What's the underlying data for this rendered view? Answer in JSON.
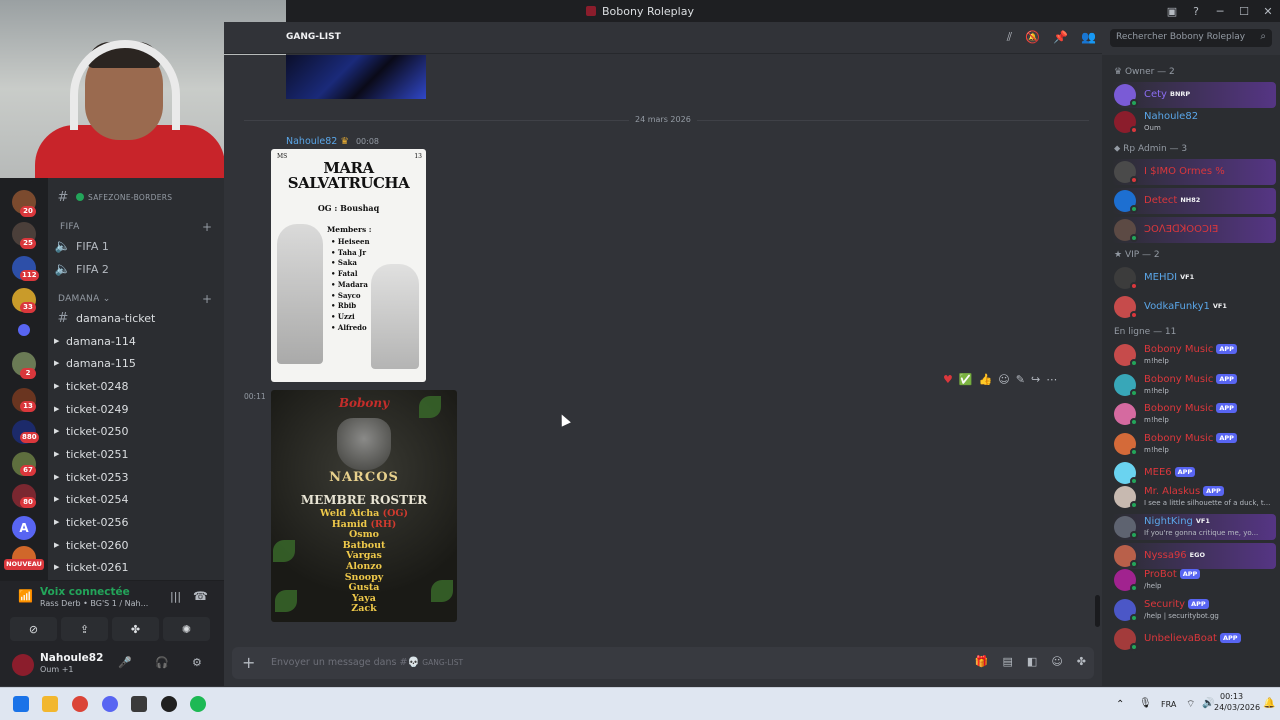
{
  "window": {
    "title": "Bobony Roleplay"
  },
  "header": {
    "channel": "GANG-LIST",
    "search_placeholder": "Rechercher Bobony Roleplay"
  },
  "servers": {
    "badges": [
      "20",
      "25",
      "112",
      "33",
      "2",
      "13",
      "880",
      "67",
      "80"
    ],
    "new_label": "NOUVEAU"
  },
  "channels": {
    "top_channel": "SAFEZONE-BORDERS",
    "fifa_category": "FIFA",
    "voice": [
      "FIFA 1",
      "FIFA 2"
    ],
    "category": "DAMANA",
    "items": [
      "damana-ticket",
      "damana-114",
      "damana-115",
      "ticket-0248",
      "ticket-0249",
      "ticket-0250",
      "ticket-0251",
      "ticket-0253",
      "ticket-0254",
      "ticket-0256",
      "ticket-0260",
      "ticket-0261"
    ]
  },
  "voice_panel": {
    "status": "Voix connectée",
    "sub": "Rass Derb • BG'S 1 / Nah..."
  },
  "user": {
    "name": "Nahoule82",
    "status": "Oum +1"
  },
  "chat": {
    "date_divider": "24 mars 2026",
    "author": "Nahoule82",
    "time1": "00:08",
    "time2": "00:11",
    "poster1": {
      "title_line1": "MARA",
      "title_line2": "SALVATRUCHA",
      "left_mark": "MS",
      "right_mark": "13",
      "og": "OG : Boushaq",
      "members_heading": "Members :",
      "members": [
        "Heiseen",
        "Taha Jr",
        "Saka",
        "Fatal",
        "Madara",
        "Sayco",
        "Rbib",
        "Uzzi",
        "Alfredo"
      ]
    },
    "poster2": {
      "brand": "Bobony",
      "title": "NARCOS",
      "subtitle": "MEMBRE ROSTER",
      "members": [
        {
          "name": "Weld Aicha",
          "tag": "(OG)"
        },
        {
          "name": "Hamid",
          "tag": "(RH)"
        },
        {
          "name": "Osmo",
          "tag": ""
        },
        {
          "name": "Batbout",
          "tag": ""
        },
        {
          "name": "Vargas",
          "tag": ""
        },
        {
          "name": "Alonzo",
          "tag": ""
        },
        {
          "name": "Snoopy",
          "tag": ""
        },
        {
          "name": "Gusta",
          "tag": ""
        },
        {
          "name": "Yaya",
          "tag": ""
        },
        {
          "name": "Zack",
          "tag": ""
        }
      ]
    },
    "composer_placeholder": "Envoyer un message dans #",
    "composer_channel": "GANG-LIST"
  },
  "members": {
    "owner_header": "Owner — 2",
    "admin_header": "Rp Admin — 3",
    "vip_header": "VIP — 2",
    "online_header": "En ligne — 11",
    "owner": [
      {
        "name": "Cety",
        "tag": "BNRP",
        "sub": "",
        "color": "#8a6cf0"
      },
      {
        "name": "Nahoule82",
        "tag": "",
        "sub": "Oum",
        "color": "#5aa6e8"
      }
    ],
    "admin": [
      {
        "name": "I $IMO Ormes %",
        "tag": "",
        "color": "#da373c"
      },
      {
        "name": "Detect",
        "tag": "NH82",
        "color": "#da373c"
      },
      {
        "name": "ƆOꓥƎꓷꓘOOƆIƎ",
        "tag": "",
        "color": "#da373c"
      }
    ],
    "vip": [
      {
        "name": "MEHDI",
        "tag": "VF1",
        "color": "#5aa6e8"
      },
      {
        "name": "VodkaFunky1",
        "tag": "VF1",
        "color": "#5aa6e8"
      }
    ],
    "online": [
      {
        "name": "Bobony Music",
        "tag": "APP",
        "sub": "m!help",
        "color": "#da373c"
      },
      {
        "name": "Bobony Music",
        "tag": "APP",
        "sub": "m!help",
        "color": "#da373c"
      },
      {
        "name": "Bobony Music",
        "tag": "APP",
        "sub": "m!help",
        "color": "#da373c"
      },
      {
        "name": "Bobony Music",
        "tag": "APP",
        "sub": "m!help",
        "color": "#da373c"
      },
      {
        "name": "MEE6",
        "tag": "APP",
        "sub": "",
        "color": "#da373c"
      },
      {
        "name": "Mr. Alaskus",
        "tag": "APP",
        "sub": "I see a little silhouette of a duck, t...",
        "color": "#da373c"
      },
      {
        "name": "NightKing",
        "tag": "VF1",
        "sub": "If you're gonna critique me, yo...",
        "color": "#5aa6e8"
      },
      {
        "name": "Nyssa96",
        "tag": "EGO",
        "sub": "",
        "color": "#da373c"
      },
      {
        "name": "ProBot",
        "tag": "APP",
        "sub": "/help",
        "color": "#da373c"
      },
      {
        "name": "Security",
        "tag": "APP",
        "sub": "/help | securitybot.gg",
        "color": "#da373c"
      },
      {
        "name": "UnbelievaBoat",
        "tag": "APP",
        "sub": "",
        "color": "#da373c"
      }
    ]
  },
  "taskbar": {
    "lang": "FRA",
    "time": "00:13",
    "date": "24/03/2026"
  }
}
